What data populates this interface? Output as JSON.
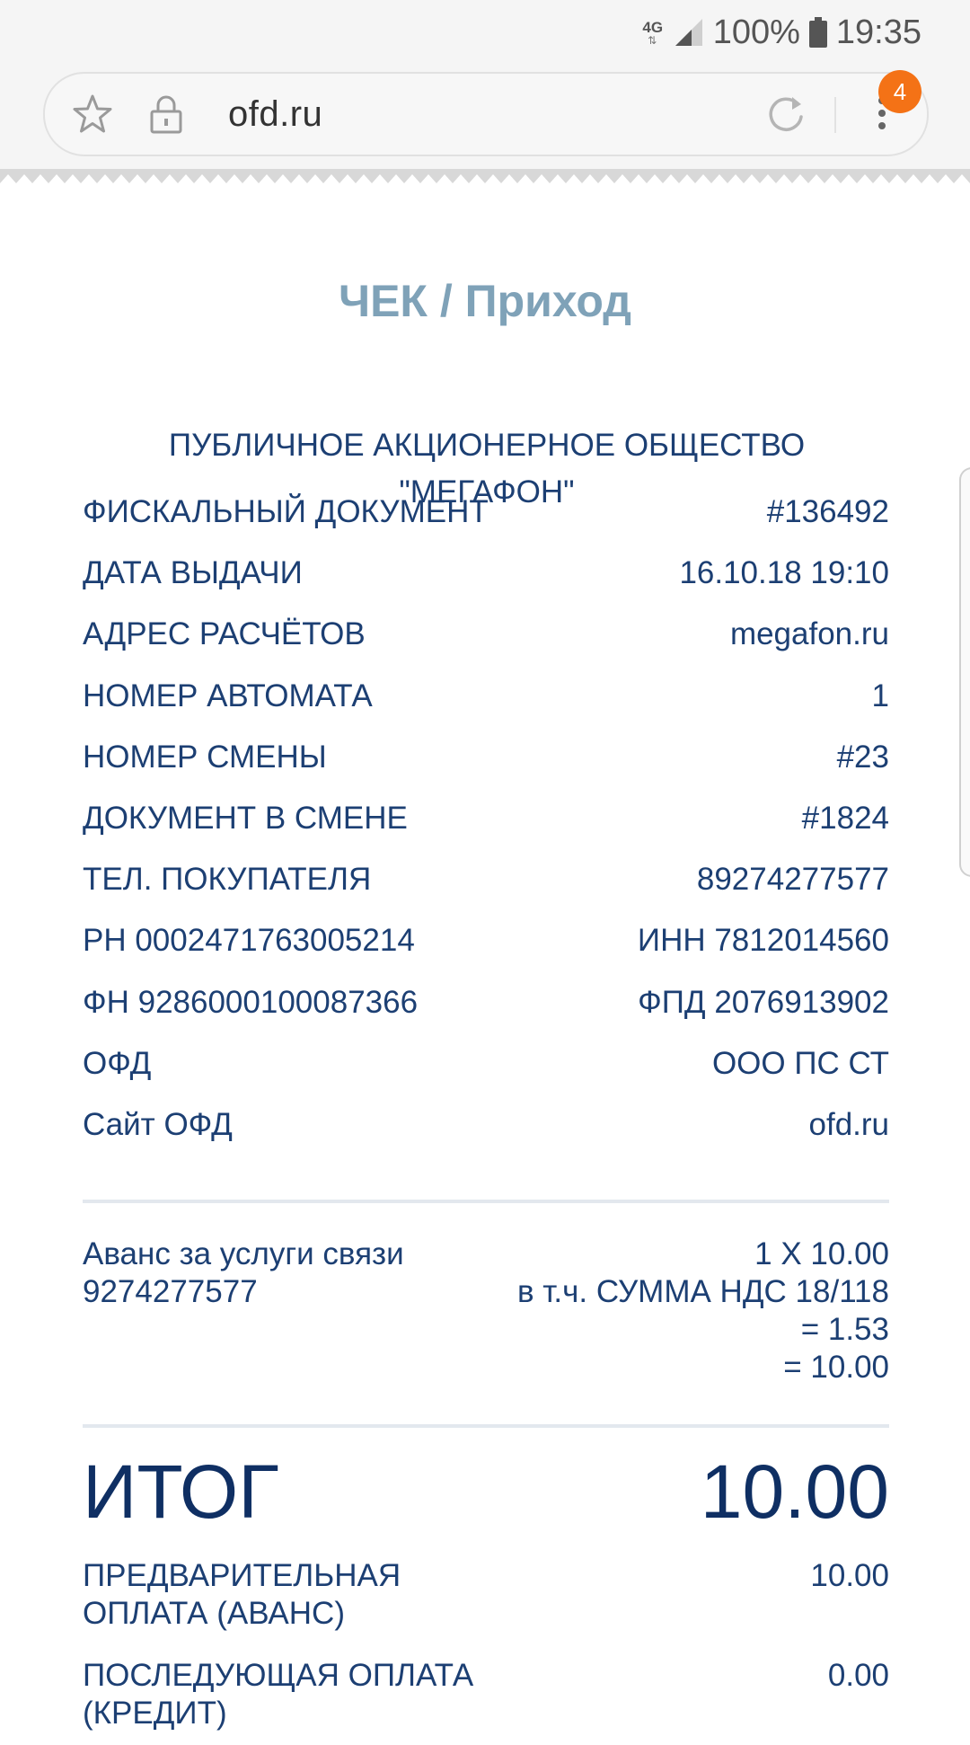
{
  "status_bar": {
    "network": "4G",
    "battery": "100%",
    "time": "19:35"
  },
  "browser": {
    "url": "ofd.ru",
    "menu_badge": "4"
  },
  "receipt": {
    "title": "ЧЕК / Приход",
    "company": "ПУБЛИЧНОЕ АКЦИОНЕРНОЕ ОБЩЕСТВО \"МЕГАФОН\"",
    "info": [
      {
        "label": "ФИСКАЛЬНЫЙ ДОКУМЕНТ",
        "value": "#136492"
      },
      {
        "label": "ДАТА ВЫДАЧИ",
        "value": "16.10.18 19:10"
      },
      {
        "label": "АДРЕС РАСЧЁТОВ",
        "value": "megafon.ru"
      },
      {
        "label": "НОМЕР АВТОМАТА",
        "value": "1"
      },
      {
        "label": "НОМЕР СМЕНЫ",
        "value": "#23"
      },
      {
        "label": "ДОКУМЕНТ В СМЕНЕ",
        "value": "#1824"
      },
      {
        "label": "ТЕЛ. ПОКУПАТЕЛЯ",
        "value": "89274277577"
      },
      {
        "label": "РН 0002471763005214",
        "value": "ИНН 7812014560"
      },
      {
        "label": "ФН 9286000100087366",
        "value": "ФПД 2076913902"
      },
      {
        "label": "ОФД",
        "value": "ООО ПС СТ"
      },
      {
        "label": "Сайт ОФД",
        "value": "ofd.ru"
      }
    ],
    "item": {
      "name_line1": "Аванс за услуги связи",
      "name_line2": "9274277577",
      "qty_price": "1 X 10.00",
      "vat_label": "в т.ч. СУММА НДС 18/118",
      "vat_value": "= 1.53",
      "sum": "= 10.00"
    },
    "total": {
      "label": "ИТОГ",
      "value": "10.00"
    },
    "payments": [
      {
        "label_line1": "ПРЕДВАРИТЕЛЬНАЯ",
        "label_line2": "ОПЛАТА (АВАНС)",
        "value": "10.00"
      },
      {
        "label_line1": "ПОСЛЕДУЮЩАЯ ОПЛАТА",
        "label_line2": "(КРЕДИТ)",
        "value": "0.00"
      }
    ]
  }
}
